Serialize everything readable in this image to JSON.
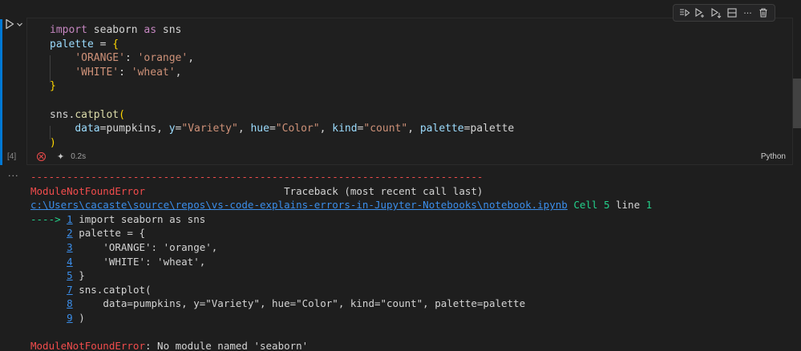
{
  "cell": {
    "execution_count": "[4]",
    "duration": "0.2s",
    "language": "Python",
    "code_lines": [
      [
        {
          "t": "kw",
          "v": "import"
        },
        {
          "t": "pl",
          "v": " seaborn "
        },
        {
          "t": "kw",
          "v": "as"
        },
        {
          "t": "pl",
          "v": " sns"
        }
      ],
      [
        {
          "t": "id",
          "v": "palette"
        },
        {
          "t": "pl",
          "v": " = "
        },
        {
          "t": "br1",
          "v": "{"
        }
      ],
      [
        {
          "t": "pl",
          "v": "    "
        },
        {
          "t": "str",
          "v": "'ORANGE'"
        },
        {
          "t": "pl",
          "v": ": "
        },
        {
          "t": "str",
          "v": "'orange'"
        },
        {
          "t": "pl",
          "v": ","
        }
      ],
      [
        {
          "t": "pl",
          "v": "    "
        },
        {
          "t": "str",
          "v": "'WHITE'"
        },
        {
          "t": "pl",
          "v": ": "
        },
        {
          "t": "str",
          "v": "'wheat'"
        },
        {
          "t": "pl",
          "v": ","
        }
      ],
      [
        {
          "t": "br1",
          "v": "}"
        }
      ],
      [
        {
          "t": "pl",
          "v": ""
        }
      ],
      [
        {
          "t": "pl",
          "v": "sns."
        },
        {
          "t": "fn",
          "v": "catplot"
        },
        {
          "t": "br1",
          "v": "("
        }
      ],
      [
        {
          "t": "pl",
          "v": "    "
        },
        {
          "t": "id",
          "v": "data"
        },
        {
          "t": "pl",
          "v": "=pumpkins, "
        },
        {
          "t": "id",
          "v": "y"
        },
        {
          "t": "pl",
          "v": "="
        },
        {
          "t": "str",
          "v": "\"Variety\""
        },
        {
          "t": "pl",
          "v": ", "
        },
        {
          "t": "id",
          "v": "hue"
        },
        {
          "t": "pl",
          "v": "="
        },
        {
          "t": "str",
          "v": "\"Color\""
        },
        {
          "t": "pl",
          "v": ", "
        },
        {
          "t": "id",
          "v": "kind"
        },
        {
          "t": "pl",
          "v": "="
        },
        {
          "t": "str",
          "v": "\"count\""
        },
        {
          "t": "pl",
          "v": ", "
        },
        {
          "t": "id",
          "v": "palette"
        },
        {
          "t": "pl",
          "v": "=palette"
        }
      ],
      [
        {
          "t": "br1",
          "v": ")"
        }
      ]
    ]
  },
  "toolbar": {
    "icons": [
      "execute-above-icon",
      "execute-cell-and-below-icon",
      "execute-below-icon",
      "split-cell-icon",
      "more-icon",
      "delete-icon"
    ]
  },
  "output": {
    "gutter": "...",
    "lines": [
      [
        {
          "t": "red",
          "v": "---------------------------------------------------------------------------"
        }
      ],
      [
        {
          "t": "red",
          "v": "ModuleNotFoundError"
        },
        {
          "t": "white",
          "v": "                       Traceback (most recent call last)"
        }
      ],
      [
        {
          "t": "link",
          "v": "c:\\Users\\cacaste\\source\\repos\\vs-code-explains-errors-in-Jupyter-Notebooks\\notebook.ipynb"
        },
        {
          "t": "white",
          "v": " "
        },
        {
          "t": "green",
          "v": "Cell 5"
        },
        {
          "t": "white",
          "v": " line "
        },
        {
          "t": "green",
          "v": "1"
        }
      ],
      [
        {
          "t": "green",
          "v": "----> "
        },
        {
          "t": "num-link",
          "v": "1"
        },
        {
          "t": "white",
          "v": " import seaborn as sns"
        }
      ],
      [
        {
          "t": "white",
          "v": "      "
        },
        {
          "t": "num-link",
          "v": "2"
        },
        {
          "t": "white",
          "v": " palette = {"
        }
      ],
      [
        {
          "t": "white",
          "v": "      "
        },
        {
          "t": "num-link",
          "v": "3"
        },
        {
          "t": "white",
          "v": "     'ORANGE': 'orange',"
        }
      ],
      [
        {
          "t": "white",
          "v": "      "
        },
        {
          "t": "num-link",
          "v": "4"
        },
        {
          "t": "white",
          "v": "     'WHITE': 'wheat',"
        }
      ],
      [
        {
          "t": "white",
          "v": "      "
        },
        {
          "t": "num-link",
          "v": "5"
        },
        {
          "t": "white",
          "v": " }"
        }
      ],
      [
        {
          "t": "white",
          "v": "      "
        },
        {
          "t": "num-link",
          "v": "7"
        },
        {
          "t": "white",
          "v": " sns.catplot("
        }
      ],
      [
        {
          "t": "white",
          "v": "      "
        },
        {
          "t": "num-link",
          "v": "8"
        },
        {
          "t": "white",
          "v": "     data=pumpkins, y=\"Variety\", hue=\"Color\", kind=\"count\", palette=palette"
        }
      ],
      [
        {
          "t": "white",
          "v": "      "
        },
        {
          "t": "num-link",
          "v": "9"
        },
        {
          "t": "white",
          "v": " )"
        }
      ],
      [
        {
          "t": "white",
          "v": ""
        }
      ],
      [
        {
          "t": "red",
          "v": "ModuleNotFoundError"
        },
        {
          "t": "white",
          "v": ": No module named 'seaborn'"
        }
      ]
    ]
  },
  "colors": {
    "accent": "#0078d4",
    "error": "#f14c4c",
    "link": "#3b8eea",
    "green": "#23d18b"
  }
}
